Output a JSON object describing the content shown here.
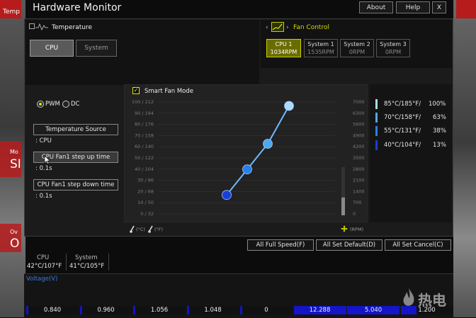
{
  "window": {
    "title": "Hardware Monitor",
    "buttons": {
      "about": "About",
      "help": "Help",
      "close": "X"
    }
  },
  "background": {
    "left_top": "Temp",
    "left_mid1": "Mo",
    "left_mid2": "SI",
    "left_low1": "Ov",
    "left_low2": "O"
  },
  "temperature": {
    "header": "Temperature",
    "tabs": [
      "CPU",
      "System"
    ],
    "active_tab": "CPU",
    "mode_pwm": "PWM",
    "mode_dc": "DC",
    "source_button": "Temperature Source",
    "source_value": ": CPU",
    "step_up_button": "CPU Fan1 step up time",
    "step_up_value": ": 0.1s",
    "step_down_button": "CPU Fan1 step down time",
    "step_down_value": ": 0.1s"
  },
  "fan_control": {
    "header": "Fan Control",
    "fans": [
      {
        "name": "CPU 1",
        "rpm": "1034RPM",
        "active": true
      },
      {
        "name": "System 1",
        "rpm": "1535RPM",
        "active": false
      },
      {
        "name": "System 2",
        "rpm": "0RPM",
        "active": false
      },
      {
        "name": "System 3",
        "rpm": "0RPM",
        "active": false
      }
    ]
  },
  "smart_fan": {
    "checkbox_label": "Smart Fan Mode",
    "checked": true,
    "unit_c": "(°C)",
    "unit_f": "(°F)",
    "unit_rpm": "(RPM)"
  },
  "chart_data": {
    "type": "line",
    "left_ticks": [
      "100 / 212",
      "90 / 194",
      "80 / 176",
      "70 / 158",
      "60 / 140",
      "50 / 122",
      "40 / 104",
      "30 / 86",
      "20 / 68",
      "10 / 50",
      "0 / 32"
    ],
    "right_ticks": [
      "7000",
      "6300",
      "5600",
      "4900",
      "4200",
      "3500",
      "2800",
      "2100",
      "1400",
      "700",
      "0"
    ],
    "x_range": [
      0,
      100
    ],
    "y_range": [
      0,
      7000
    ],
    "points": [
      {
        "speed_pct": 13,
        "color": "#1a3fd8"
      },
      {
        "speed_pct": 38,
        "color": "#2a7fe8"
      },
      {
        "speed_pct": 63,
        "color": "#4ea8ee"
      },
      {
        "speed_pct": 100,
        "color": "#a8dcfa"
      }
    ],
    "current_rpm_level": 1034,
    "grid": true
  },
  "legend": [
    {
      "temp": "85°C/185°F/",
      "pct": "100%",
      "color": "#a8dcfa"
    },
    {
      "temp": "70°C/158°F/",
      "pct": "63%",
      "color": "#4ea8ee"
    },
    {
      "temp": "55°C/131°F/",
      "pct": "38%",
      "color": "#2a7fe8"
    },
    {
      "temp": "40°C/104°F/",
      "pct": "13%",
      "color": "#1a3fd8"
    }
  ],
  "actions": {
    "full_speed": "All Full Speed(F)",
    "set_default": "All Set Default(D)",
    "set_cancel": "All Set Cancel(C)"
  },
  "status": {
    "cpu_label": "CPU",
    "cpu_value": "42°C/107°F",
    "system_label": "System",
    "system_value": "41°C/105°F"
  },
  "voltage": {
    "label": "Voltage(V)",
    "readings": [
      {
        "value": "0.840",
        "fill": 0.04
      },
      {
        "value": "0.960",
        "fill": 0.04
      },
      {
        "value": "1.056",
        "fill": 0.04
      },
      {
        "value": "1.048",
        "fill": 0.04
      },
      {
        "value": "0",
        "fill": 0.0
      },
      {
        "value": "12.288",
        "fill": 1.0
      },
      {
        "value": "5.040",
        "fill": 1.0
      },
      {
        "value": "1.200",
        "fill": 0.3
      }
    ]
  },
  "watermark": "热电"
}
